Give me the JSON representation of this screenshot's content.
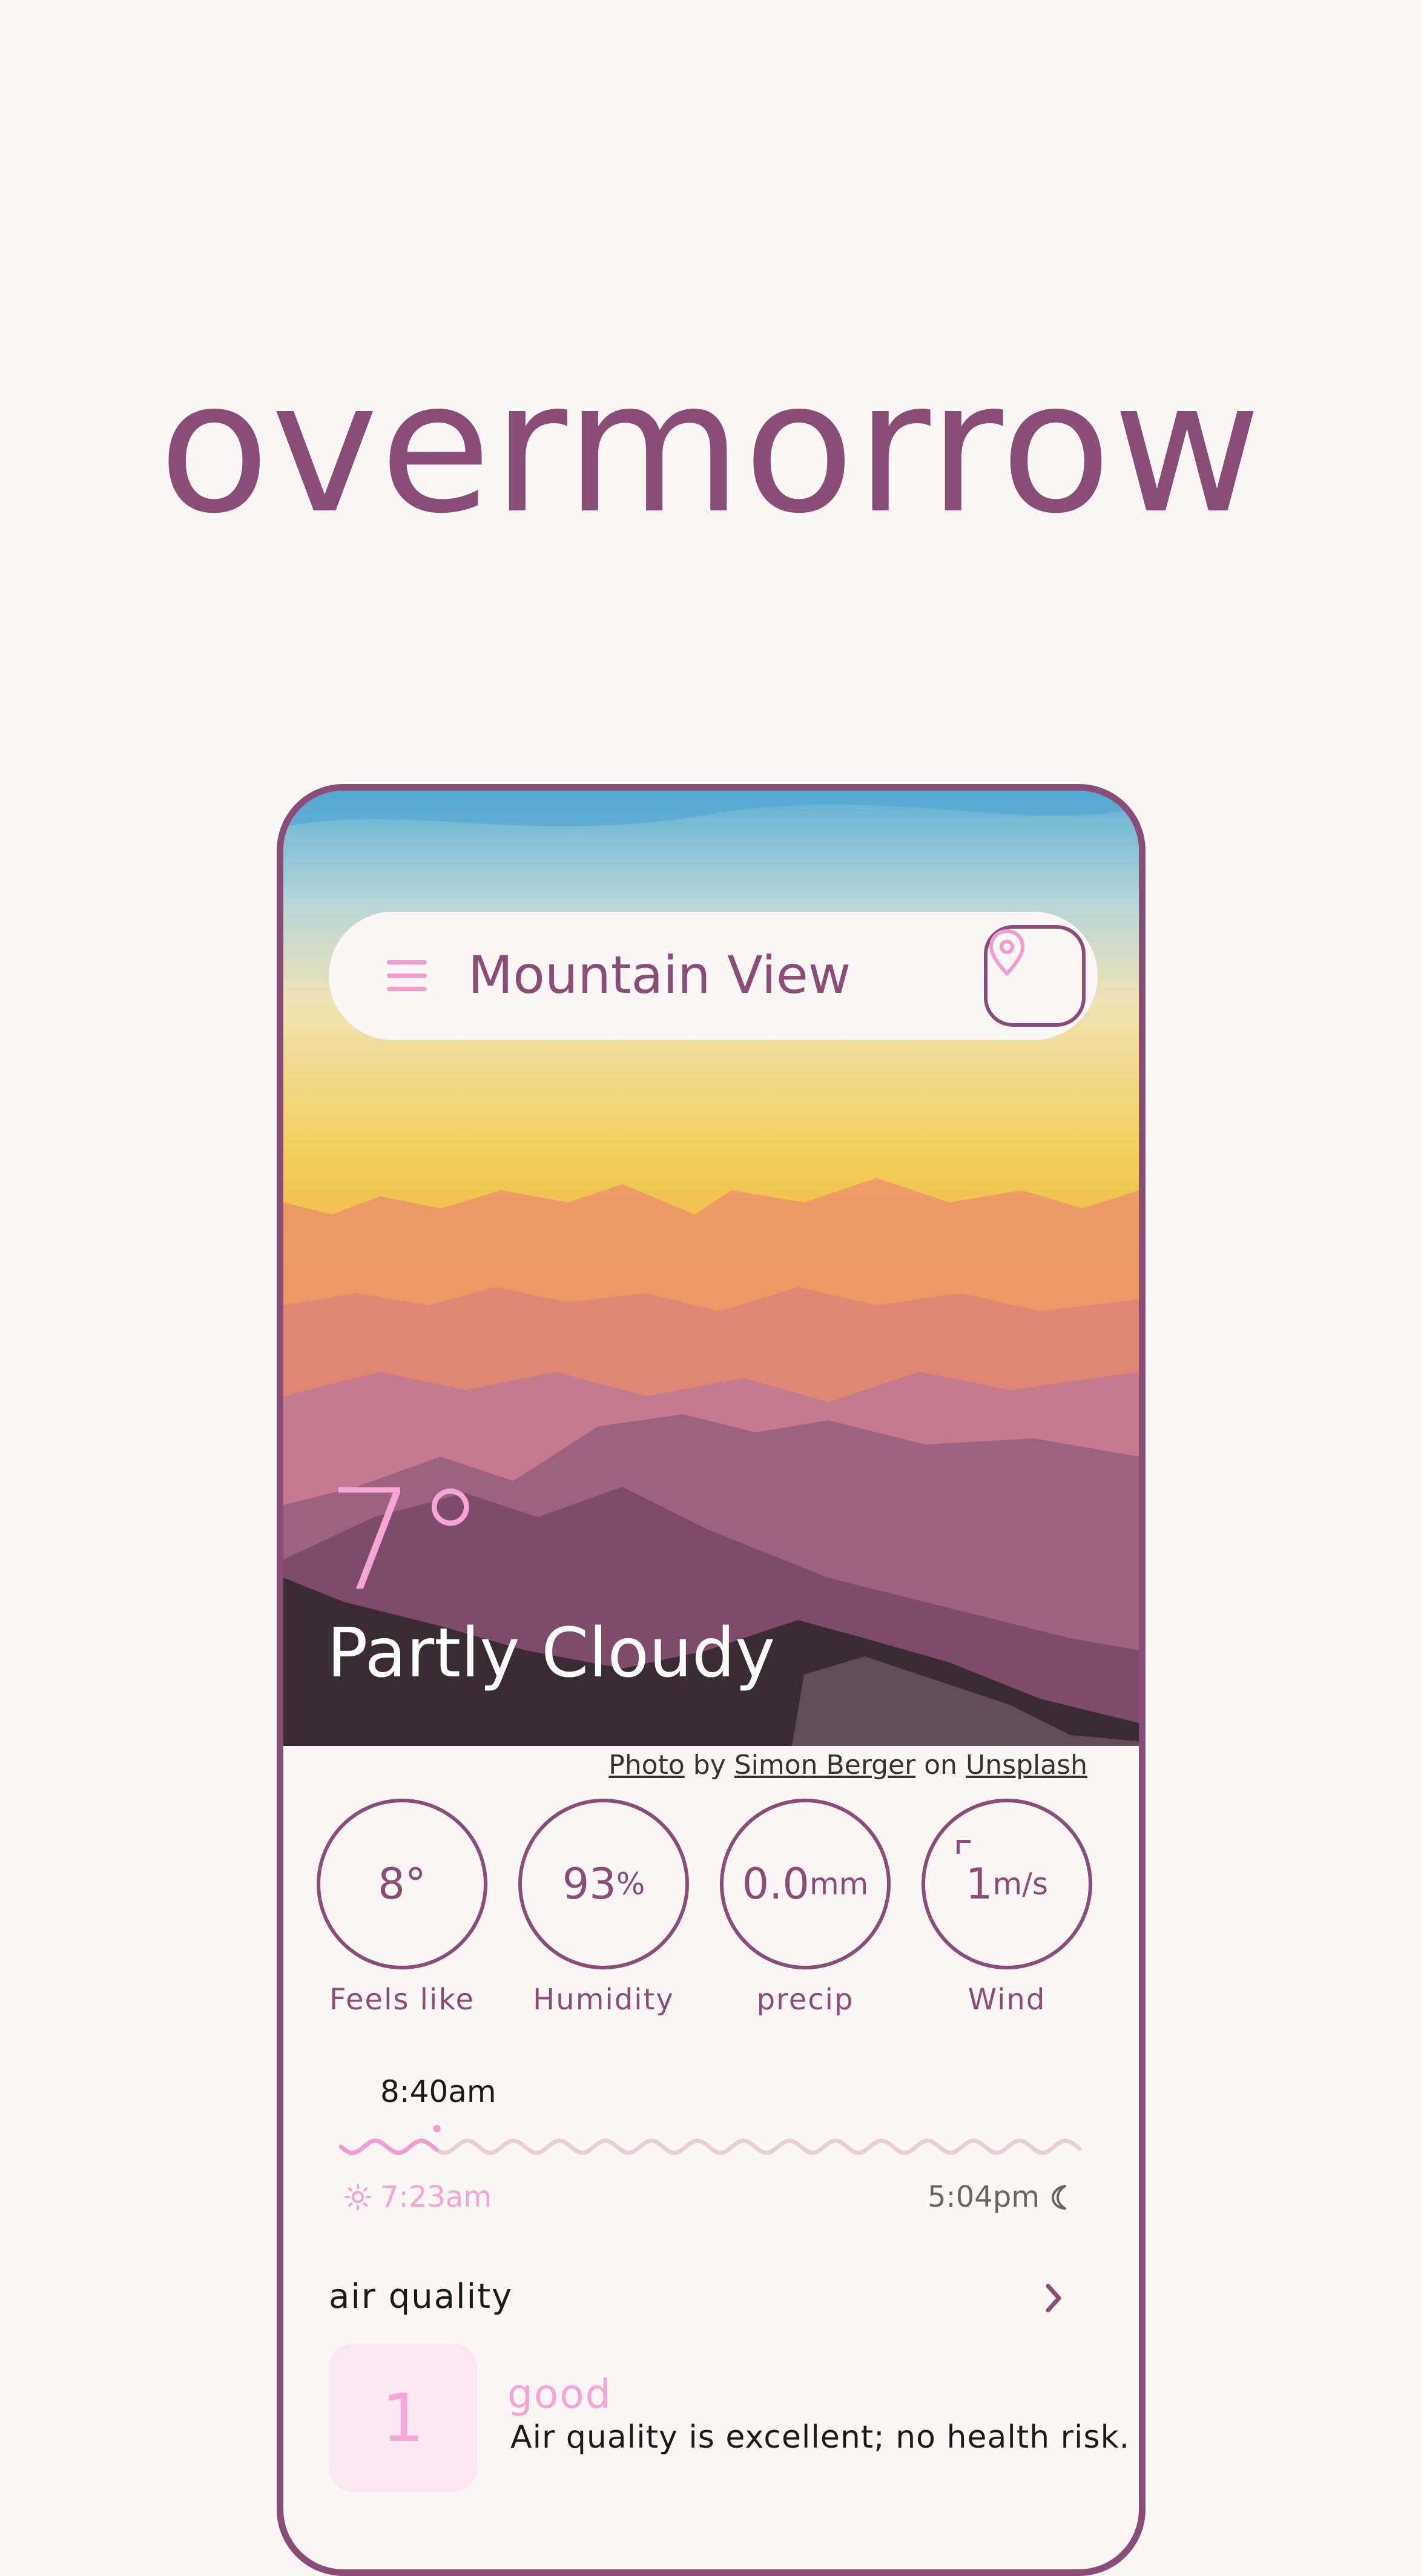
{
  "app": {
    "title": "overmorrow"
  },
  "search": {
    "city": "Mountain View"
  },
  "current": {
    "temperature": "7°",
    "condition": "Partly Cloudy"
  },
  "credit": {
    "photo": "Photo",
    "by": "by",
    "author": "Simon Berger",
    "on": "on",
    "source": "Unsplash"
  },
  "stats": [
    {
      "value": "8°",
      "unit": "",
      "label": "Feels like"
    },
    {
      "value": "93",
      "unit": "%",
      "label": "Humidity"
    },
    {
      "value": "0.0",
      "unit": "mm",
      "label": "precip"
    },
    {
      "value": "1",
      "unit": "m/s",
      "label": "Wind"
    }
  ],
  "sun": {
    "now": "8:40am",
    "sunrise": "7:23am",
    "sunset": "5:04pm",
    "day_progress": 0.13
  },
  "air_quality": {
    "title": "air quality",
    "index": "1",
    "level": "good",
    "description": "Air quality is excellent; no health risk."
  },
  "colors": {
    "accent": "#8a4d78",
    "pink": "#f6a6d6",
    "background": "#fdf6f6"
  },
  "icons": [
    "menu-icon",
    "location-pin-icon",
    "sun-icon",
    "moon-icon",
    "chevron-right-icon",
    "wind-direction-icon"
  ]
}
